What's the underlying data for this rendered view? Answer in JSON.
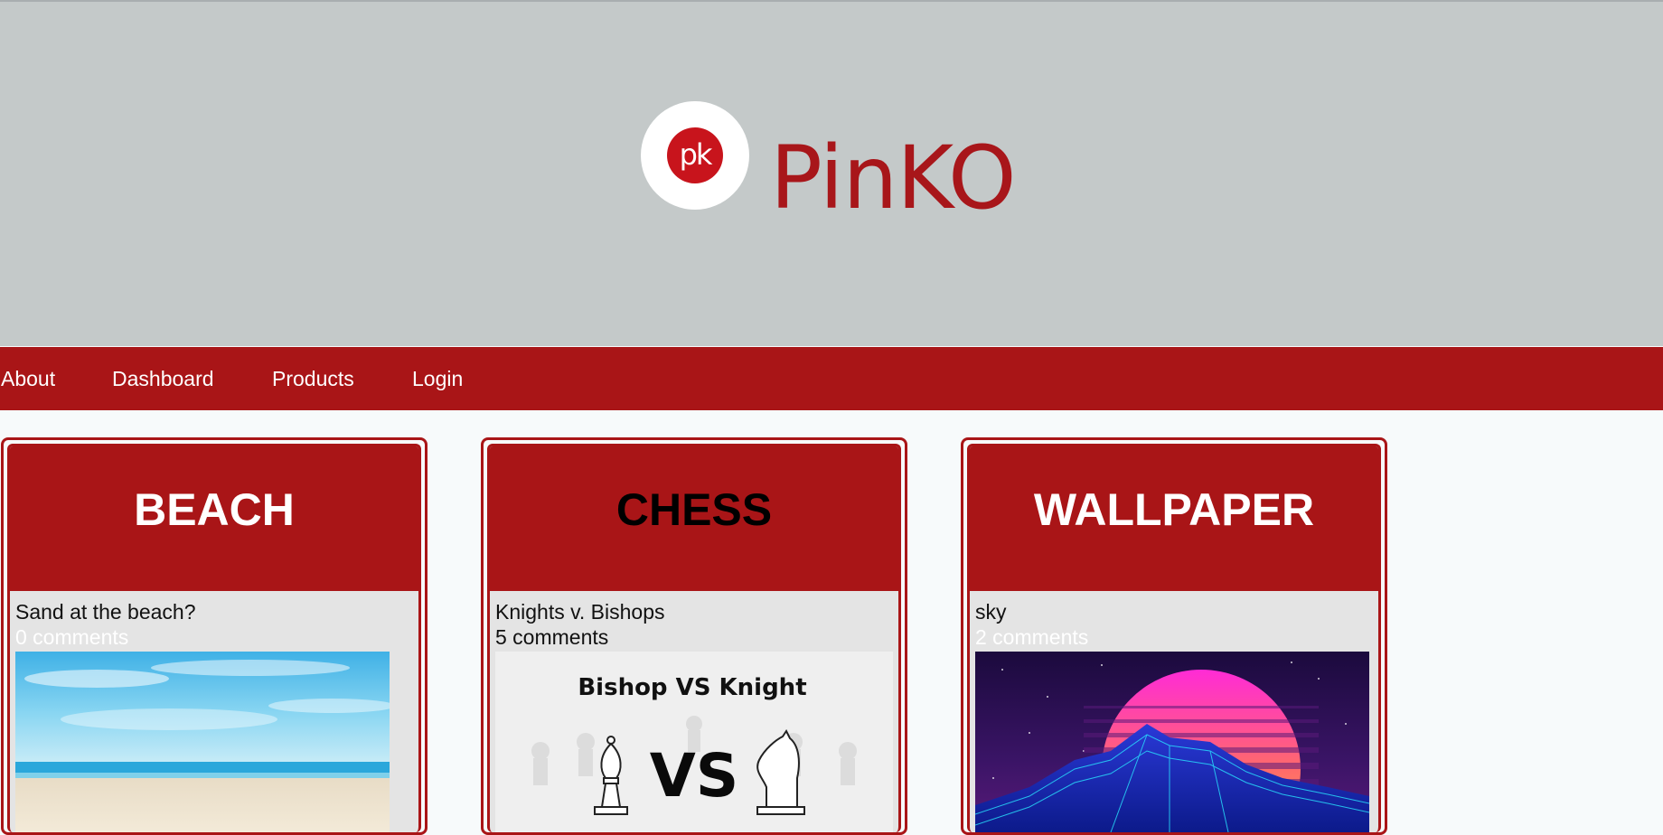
{
  "header": {
    "logo_text": "pk",
    "brand": "PinKO"
  },
  "nav": {
    "items": [
      "About",
      "Dashboard",
      "Products",
      "Login"
    ]
  },
  "cards": [
    {
      "heading": "BEACH",
      "heading_color": "#ffffff",
      "title": "Sand at the beach?",
      "comments": "0 comments",
      "comments_color": "#ffffff"
    },
    {
      "heading": "CHESS",
      "heading_color": "#000000",
      "title": "Knights v. Bishops",
      "comments": "5 comments",
      "comments_color": "#111111",
      "image_text": {
        "caption": "Bishop VS Knight",
        "vs": "VS"
      }
    },
    {
      "heading": "WALLPAPER",
      "heading_color": "#ffffff",
      "title": "sky",
      "comments": "2 comments",
      "comments_color": "#ffffff"
    }
  ],
  "colors": {
    "header_bg": "#c4c9c9",
    "brand_red": "#a91517",
    "page_bg": "#f7fafb"
  }
}
